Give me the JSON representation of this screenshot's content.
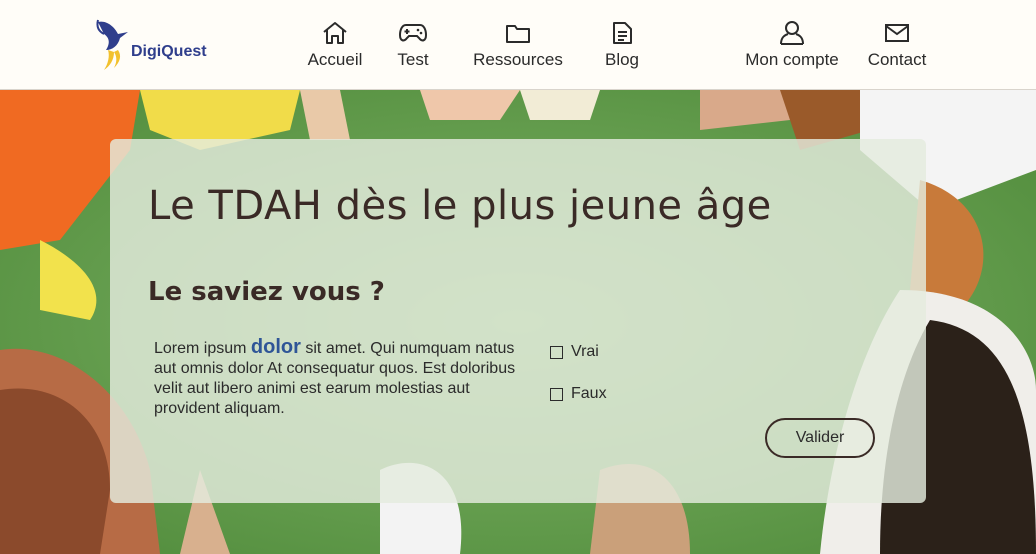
{
  "header": {
    "logo_text": "DigiQuest",
    "nav": [
      {
        "label": "Accueil",
        "icon": "home-icon"
      },
      {
        "label": "Test",
        "icon": "gamepad-icon"
      },
      {
        "label": "Ressources",
        "icon": "folder-icon"
      },
      {
        "label": "Blog",
        "icon": "document-icon"
      },
      {
        "label": "Mon compte",
        "icon": "user-icon"
      },
      {
        "label": "Contact",
        "icon": "mail-icon"
      }
    ]
  },
  "main": {
    "title": "Le TDAH dès le plus jeune âge",
    "subtitle": "Le saviez vous ?",
    "question_before": "Lorem ipsum ",
    "question_highlight": "dolor",
    "question_after": " sit amet. Qui numquam natus aut omnis dolor At consequatur quos. Est doloribus velit aut libero animi est earum molestias aut provident aliquam.",
    "options": [
      {
        "label": "Vrai"
      },
      {
        "label": "Faux"
      }
    ],
    "submit_label": "Valider"
  },
  "colors": {
    "brand": "#2f3e8c",
    "highlight": "#2f5597",
    "text_dark": "#3a2a26",
    "header_bg": "#fffdf8",
    "card_bg": "#e4ecde"
  }
}
